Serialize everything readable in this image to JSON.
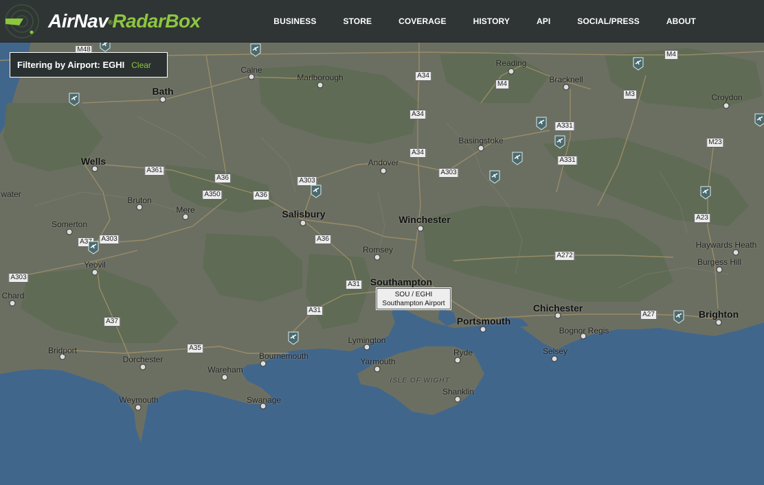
{
  "brand": {
    "airnav": "AirNav",
    "reg": "®",
    "radarbox": "RadarBox"
  },
  "nav": [
    "BUSINESS",
    "STORE",
    "COVERAGE",
    "HISTORY",
    "API",
    "SOCIAL/PRESS",
    "ABOUT"
  ],
  "filter": {
    "text": "Filtering by Airport: EGHI",
    "clear": "Clear"
  },
  "airport": {
    "code": "SOU / EGHI",
    "name": "Southampton Airport"
  },
  "places": {
    "bath": "Bath",
    "calne": "Calne",
    "marlborough": "Marlborough",
    "reading": "Reading",
    "bracknell": "Bracknell",
    "croydon": "Croydon",
    "wells": "Wells",
    "andover": "Andover",
    "basingstoke": "Basingstoke",
    "bruton": "Bruton",
    "mere": "Mere",
    "salisbury": "Salisbury",
    "winchester": "Winchester",
    "somerton": "Somerton",
    "romsey": "Romsey",
    "haywards_heath": "Haywards Heath",
    "burgess_hill": "Burgess Hill",
    "yeovil": "Yeovil",
    "southampton": "Southampton",
    "chard": "Chard",
    "chichester": "Chichester",
    "portsmouth": "Portsmouth",
    "brighton": "Brighton",
    "bognor_regis": "Bognor Regis",
    "lymington": "Lymington",
    "bridport": "Bridport",
    "dorchester": "Dorchester",
    "bournemouth": "Bournemouth",
    "ryde": "Ryde",
    "yarmouth": "Yarmouth",
    "selsey": "Selsey",
    "wareham": "Wareham",
    "isle_of_wight": "ISLE OF WIGHT",
    "shanklin": "Shanklin",
    "swanage": "Swanage",
    "weymouth": "Weymouth",
    "water": "water"
  },
  "roads": {
    "m4a": "M4",
    "m4b": "M4",
    "m3": "M3",
    "m23": "M23",
    "m48": "M48",
    "a34a": "A34",
    "a34b": "A34",
    "a34c": "A34",
    "a331a": "A331",
    "a331b": "A331",
    "a361": "A361",
    "a36a": "A36",
    "a36b": "A36",
    "a36c": "A36",
    "a350": "A350",
    "a303a": "A303",
    "a303b": "A303",
    "a303c": "A303",
    "a303d": "A303",
    "a23": "A23",
    "a37a": "A37",
    "a37b": "A37",
    "a272": "A272",
    "a31a": "A31",
    "a31b": "A31",
    "a35": "A35",
    "a27": "A27"
  },
  "colors": {
    "land": "#6b6f62",
    "forest": "#5f6b55",
    "sea": "#41668c",
    "accent": "#8dc63f",
    "header": "#2f3535"
  }
}
